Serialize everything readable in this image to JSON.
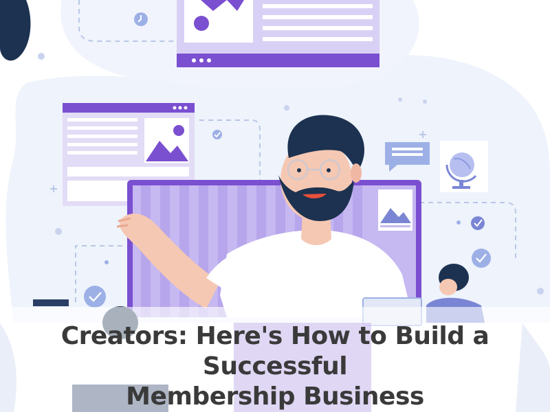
{
  "headline": {
    "line1": "Creators: Here's How to Build a Successful",
    "line2": "Membership Business"
  },
  "colors": {
    "purple": "#7a4fd0",
    "lavender": "#d9d1f5",
    "pale_blue": "#eef3fc",
    "beard": "#1c3250",
    "title_text": "#3a3a3a"
  },
  "icons": [
    "check-icon",
    "clock-icon",
    "image-icon",
    "chat-bubble-icon",
    "globe-icon"
  ]
}
